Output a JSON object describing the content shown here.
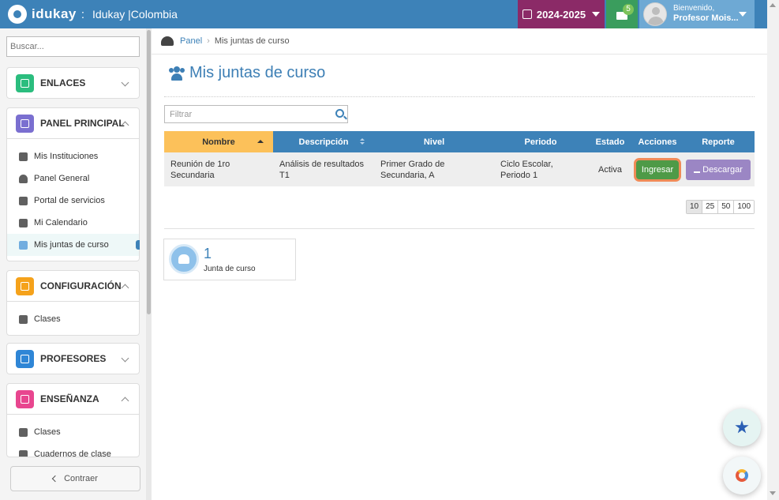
{
  "header": {
    "brand": "idukay",
    "separator": ":",
    "school": "Idukay |Colombia",
    "year": "2024-2025",
    "messages_count": "5",
    "greeting": "Bienvenido,",
    "user_name": "Profesor Mois..."
  },
  "sidebar": {
    "search_placeholder": "Buscar...",
    "sections": [
      {
        "title": "ENLACES",
        "color": "#2bbd7e"
      },
      {
        "title": "PANEL PRINCIPAL",
        "color": "#7a6fd0",
        "items": [
          "Mis Instituciones",
          "Panel General",
          "Portal de servicios",
          "Mi Calendario",
          "Mis juntas de curso"
        ]
      },
      {
        "title": "CONFIGURACIÓN",
        "color": "#f5a21b",
        "items": [
          "Clases"
        ]
      },
      {
        "title": "PROFESORES",
        "color": "#2f86d6"
      },
      {
        "title": "ENSEÑANZA",
        "color": "#e8468f",
        "items": [
          "Clases",
          "Cuadernos de clase"
        ]
      }
    ],
    "collapse_label": "Contraer"
  },
  "breadcrumb": {
    "home": "Panel",
    "current": "Mis juntas de curso"
  },
  "page": {
    "title": "Mis juntas de curso",
    "filter_placeholder": "Filtrar"
  },
  "table": {
    "headers": [
      "Nombre",
      "Descripción",
      "Nivel",
      "Periodo",
      "Estado",
      "Acciones",
      "Reporte"
    ],
    "rows": [
      {
        "nombre": "Reunión de 1ro Secundaria",
        "descripcion": "Análisis de resultados T1",
        "nivel": "Primer Grado de Secundaria, A",
        "periodo": "Ciclo Escolar, Periodo 1",
        "estado": "Activa",
        "accion": "Ingresar",
        "reporte": "Descargar"
      }
    ]
  },
  "pagination": [
    "10",
    "25",
    "50",
    "100"
  ],
  "summary": {
    "count": "1",
    "label": "Junta de curso"
  },
  "colors": {
    "primary": "#3d82b8",
    "year": "#8b2a67",
    "messages": "#3a9d5d",
    "ingresar": "#4e9a47",
    "descargar": "#9b86c4",
    "sorted": "#fcc15a"
  }
}
